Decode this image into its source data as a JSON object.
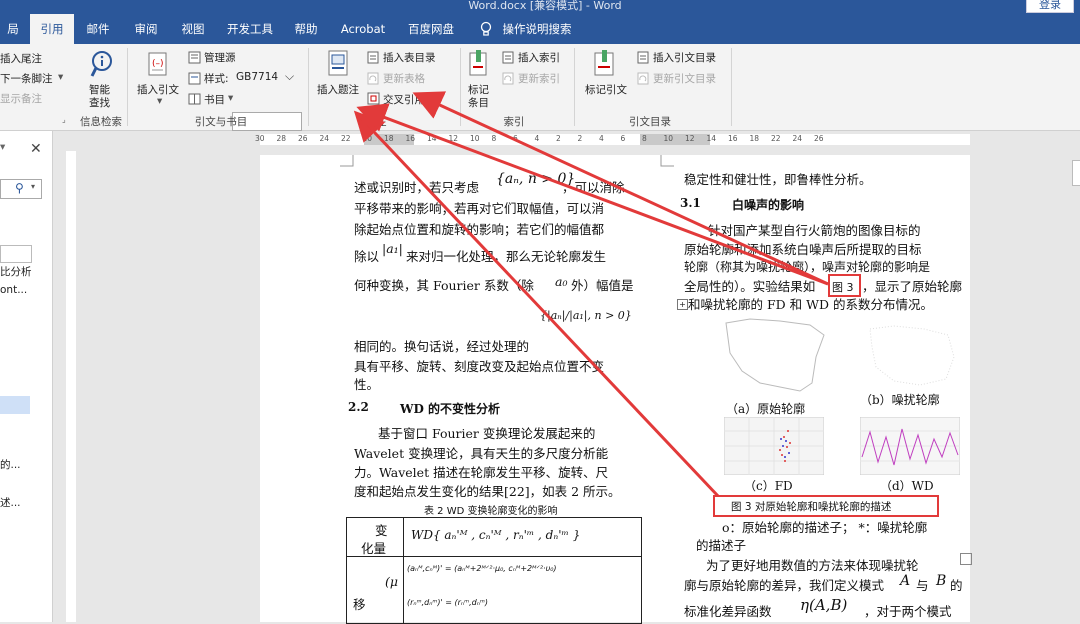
{
  "title_bar": {
    "title": "Word.docx [兼容模式] - Word",
    "login": "登录"
  },
  "tabs": [
    "局",
    "引用",
    "邮件",
    "审阅",
    "视图",
    "开发工具",
    "帮助",
    "Acrobat",
    "百度网盘",
    "操作说明搜索"
  ],
  "ribbon": {
    "left_items": [
      "插入尾注",
      "下一条脚注",
      "显示备注"
    ],
    "smart_lookup": [
      "智能",
      "查找"
    ],
    "insert_citation": "插入引文",
    "manage_sources": "管理源",
    "style_label": "样式:",
    "style_value": "GB7714",
    "bibliography": "书目",
    "insert_caption": "插入题注",
    "insert_table_of_figures": "插入表目录",
    "update_table": "更新表格",
    "cross_reference": "交叉引用",
    "mark_entry": [
      "标记",
      "条目"
    ],
    "insert_index": "插入索引",
    "update_index": "更新索引",
    "mark_citation": "标记引文",
    "insert_table_of_authorities": "插入引文目录",
    "update_table_of_authorities": "更新引文目录",
    "groups": [
      "信息检索",
      "引文与书目",
      "题注",
      "索引",
      "引文目录"
    ]
  },
  "left_pane": {
    "items": [
      "比分析",
      "ont...",
      "的...",
      "述..."
    ]
  },
  "ruler_numbers": [
    "30",
    "28",
    "26",
    "24",
    "22",
    "20",
    "18",
    "16",
    "14",
    "12",
    "10",
    "8",
    "6",
    "4",
    "2",
    "2",
    "4",
    "6",
    "8",
    "10",
    "12",
    "14",
    "16",
    "18",
    "22",
    "24",
    "26"
  ],
  "document": {
    "left_col": [
      "述或识别时，若只考虑",
      "，可以消除",
      "平移带来的影响；若再对它们取幅值，可以消",
      "除起始点位置和旋转的影响；若它们的幅值都",
      "除以",
      "来对归一化处理，那么无论轮廓发生",
      "何种变换，其 Fourier 系数（除",
      "外）幅值是",
      "相同的。换句话说，经过处理的",
      "具有平移、旋转、刻度改变及起始点位置不变",
      "性。"
    ],
    "math": {
      "set1": "{aₙ, n > 0}",
      "norm": "|a₁|",
      "a0": "a₀",
      "set2": "{|aₙ|/|a₁|, n > 0}"
    },
    "section_22": {
      "num": "2.2",
      "title": "WD 的不变性分析"
    },
    "para_22": [
      "基于窗口 Fourier 变换理论发展起来的",
      "Wavelet 变换理论，具有天生的多尺度分析能",
      "力。Wavelet 描述在轮廓发生平移、旋转、尺",
      "度和起始点发生变化的结果[22]，如表 2 所示。"
    ],
    "table_caption": "表 2 WD 变换轮廓变化的影响",
    "table": {
      "h1a": "变",
      "h1b": "化量",
      "h2": "WD{ aₙ'ᴹ , cₙ'ᴹ , rₙ'ᵐ , dₙ'ᵐ }",
      "row1": "移",
      "mu": "(μ",
      "eq1": "(aₙᴹ,cₙᴹ)' = (aₙᴹ+2ᴹᐟ²·μ₀, cₙᴹ+2ᴹᐟ²·υ₀)",
      "eq2": "(rₙᵐ,dₙᵐ)' = (rₙᵐ,dₙᵐ)"
    },
    "right_col": {
      "line0": "稳定性和健壮性，即鲁棒性分析。",
      "sec_num": "3.1",
      "sec_title": "白噪声的影响",
      "p1": [
        "针对国产某型自行火箭炮的图像目标的",
        "原始轮廓和添加系统白噪声后所提取的目标",
        "轮廓（称其为噪扰轮廓），噪声对轮廓的影响是",
        "全局性的）。实验结果如",
        "，显示了原始轮廓",
        "和噪扰轮廓的 FD 和 WD 的系数分布情况。"
      ],
      "fig_ref": "图 3",
      "sub_a": "（a）原始轮廓",
      "sub_b": "（b）噪扰轮廓",
      "sub_c": "（c）FD",
      "sub_d": "（d）WD",
      "fig_caption": "图 3 对原始轮廓和噪扰轮廓的描述",
      "legend": [
        "o：原始轮廓的描述子；  *：噪扰轮廓",
        "的描述子"
      ],
      "p2": [
        "为了更好地用数值的方法来体现噪扰轮",
        "廓与原始轮廓的差异，我们定义模式",
        "与",
        "的",
        "标准化差异函数",
        "，对于两个模式"
      ],
      "A": "A",
      "B": "B",
      "eta": "η(A,B)"
    }
  },
  "colors": {
    "word_blue": "#2b579a",
    "annotation_red": "#e23a3a"
  }
}
